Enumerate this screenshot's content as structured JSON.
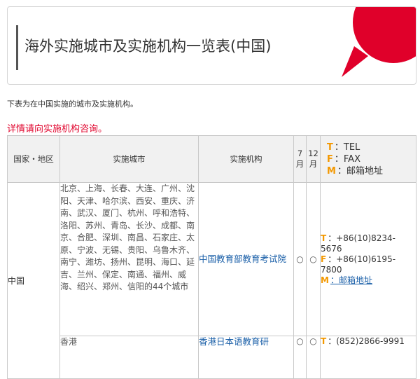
{
  "page": {
    "title": "海外实施城市及实施机构一览表(中国)",
    "intro": "下表为在中国实施的城市及实施机构。",
    "contact_note": "详情请向实施机构咨询。"
  },
  "colors": {
    "accent_red": "#e0002a",
    "label_orange": "#f39800",
    "link_blue": "#1a5fa8"
  },
  "table": {
    "headers": {
      "region": "国家・地区",
      "cities": "实施城市",
      "institution": "实施机构",
      "july": "7月",
      "december": "12月"
    },
    "legend": {
      "tel_key": "T",
      "tel_label": "：TEL",
      "fax_key": "F",
      "fax_label": "：FAX",
      "mail_key": "M",
      "mail_label": "：邮箱地址"
    },
    "rows": [
      {
        "region": "中国",
        "cities": "北京、上海、长春、大连、广州、沈阳、天津、哈尔滨、西安、重庆、济南、武汉、厦门、杭州、呼和浩特、洛阳、苏州、青岛、长沙、成都、南京、合肥、深圳、南昌、石家庄、太原、宁波、无锡、贵阳、乌鲁木齐、南宁、潍坊、扬州、昆明、海口、延吉、兰州、保定、南通、福州、威海、绍兴、郑州、信阳的44个城市",
        "institution": "中国教育部教育考试院",
        "july": "○",
        "december": "○",
        "tel": "：+86(10)8234-5676",
        "fax": "：+86(10)6195-7800",
        "mail": "：邮箱地址"
      },
      {
        "region": "",
        "cities": "香港",
        "institution": "香港日本语教育研",
        "july": "○",
        "december": "○",
        "tel": "：(852)2866-9991"
      }
    ]
  }
}
